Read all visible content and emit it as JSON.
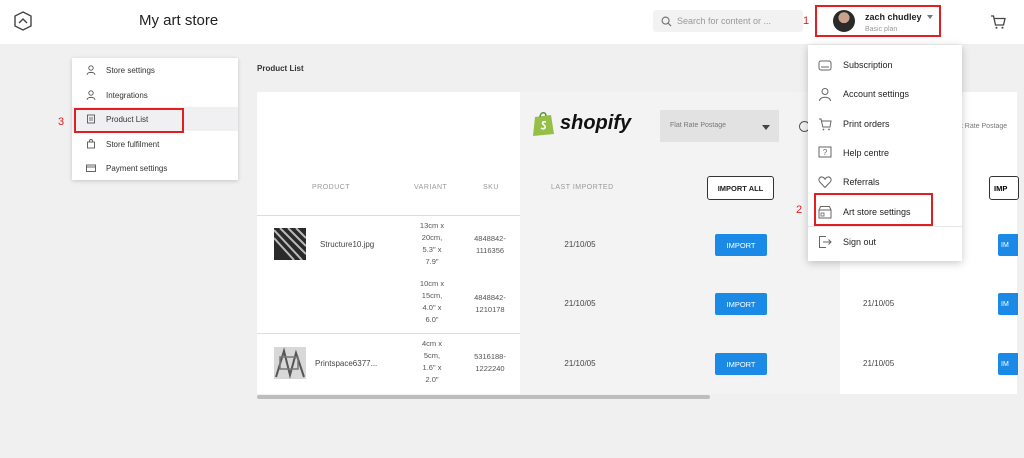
{
  "header": {
    "store_title": "My art store",
    "search_placeholder": "Search for content or ...",
    "user_name": "zach chudley",
    "user_plan": "Basic plan"
  },
  "annotations": [
    "1",
    "2",
    "3"
  ],
  "sidebar": {
    "items": [
      {
        "label": "Store settings",
        "icon": "user-icon"
      },
      {
        "label": "Integrations",
        "icon": "user-icon"
      },
      {
        "label": "Product List",
        "icon": "list-icon",
        "active": true
      },
      {
        "label": "Store fulfilment",
        "icon": "bag-icon"
      },
      {
        "label": "Payment settings",
        "icon": "card-icon"
      }
    ]
  },
  "main": {
    "title": "Product List",
    "columns": {
      "product": "PRODUCT",
      "variant": "VARIANT",
      "sku": "SKU",
      "last_imported": "LAST IMPORTED"
    },
    "brand": "shopify",
    "postage_select": "Flat Rate Postage",
    "postage_select_second": "at Rate Postage",
    "import_all_label": "IMPORT ALL",
    "import_label": "IMPORT",
    "edge_import_all_label": "IMP",
    "edge_import_label": "IM",
    "rows": [
      {
        "product": "Structure10.jpg",
        "variant": [
          "13cm x",
          "20cm,",
          "5.3\" x",
          "7.9\""
        ],
        "sku": [
          "4848842-",
          "1116356"
        ],
        "last_imported": "21/10/05",
        "second_date": ""
      },
      {
        "product": "",
        "variant": [
          "10cm x",
          "15cm,",
          "4.0\" x",
          "6.0\""
        ],
        "sku": [
          "4848842-",
          "1210178"
        ],
        "last_imported": "21/10/05",
        "second_date": "21/10/05"
      },
      {
        "product": "Printspace6377...",
        "variant": [
          "4cm x",
          "5cm,",
          "1.6\" x",
          "2.0\""
        ],
        "sku": [
          "5316188-",
          "1222240"
        ],
        "last_imported": "21/10/05",
        "second_date": "21/10/05"
      }
    ]
  },
  "menu": {
    "items": [
      {
        "label": "Subscription",
        "icon": "subscription-icon"
      },
      {
        "label": "Account settings",
        "icon": "user-icon"
      },
      {
        "label": "Print orders",
        "icon": "cart-icon"
      },
      {
        "label": "Help centre",
        "icon": "help-icon"
      },
      {
        "label": "Referrals",
        "icon": "heart-icon"
      },
      {
        "label": "Art store settings",
        "icon": "store-icon"
      },
      {
        "label": "Sign out",
        "icon": "signout-icon"
      }
    ]
  },
  "colors": {
    "accent": "#1a8ae6",
    "annotation": "#e02020",
    "shopify_green": "#95bf47"
  }
}
